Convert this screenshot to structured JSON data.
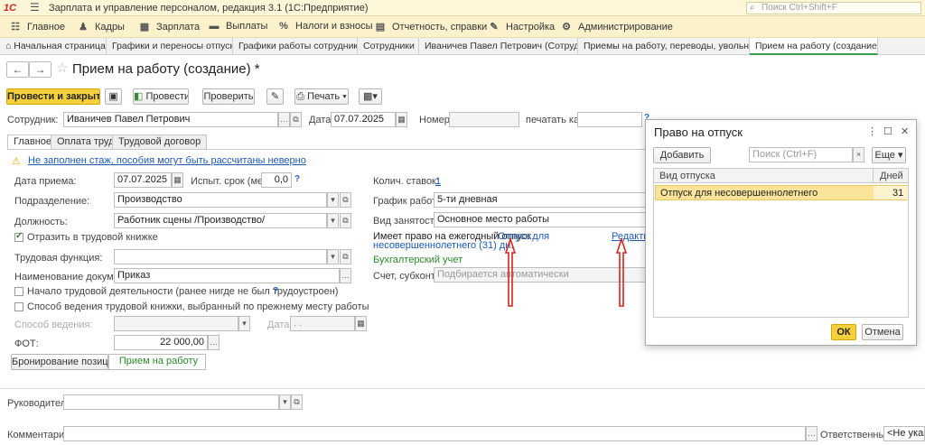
{
  "titlebar": {
    "logo": "1С",
    "app_title": "Зарплата и управление персоналом, редакция 3.1  (1С:Предприятие)",
    "search_placeholder": "Поиск Ctrl+Shift+F"
  },
  "menu": [
    {
      "label": "Главное",
      "icon": "grid-icon"
    },
    {
      "label": "Кадры",
      "icon": "people-icon"
    },
    {
      "label": "Зарплата",
      "icon": "calculator-icon"
    },
    {
      "label": "Выплаты",
      "icon": "wallet-icon"
    },
    {
      "label": "Налоги и взносы",
      "icon": "percent-icon"
    },
    {
      "label": "Отчетность, справки",
      "icon": "report-icon"
    },
    {
      "label": "Настройка",
      "icon": "wrench-icon"
    },
    {
      "label": "Администрирование",
      "icon": "gear-icon"
    }
  ],
  "tabs": [
    {
      "label": "Начальная страница"
    },
    {
      "label": "Графики и переносы отпусков"
    },
    {
      "label": "Графики работы сотрудников"
    },
    {
      "label": "Сотрудники"
    },
    {
      "label": "Иваничев Павел Петрович (Сотрудник)"
    },
    {
      "label": "Приемы на работу, переводы, увольнения"
    },
    {
      "label": "Прием на работу (создание) *"
    }
  ],
  "document": {
    "title": "Прием на работу (создание) *"
  },
  "toolbar": {
    "post_close": "Провести и закрыть",
    "post": "Провести",
    "check": "Проверить",
    "print": "Печать"
  },
  "header": {
    "employee_label": "Сотрудник:",
    "employee_value": "Иваничев Павел Петрович",
    "date_label": "Дата:",
    "date_value": "07.07.2025",
    "number_label": "Номер:",
    "print_as_label": "печатать как:"
  },
  "form_tabs": [
    "Главное",
    "Оплата труда",
    "Трудовой договор"
  ],
  "main": {
    "warning": "Не заполнен стаж, пособия могут быть рассчитаны неверно",
    "hire_date_label": "Дата приема:",
    "hire_date_value": "07.07.2025",
    "probation_label": "Испыт. срок (мес):",
    "probation_value": "0,0",
    "department_label": "Подразделение:",
    "department_value": "Производство",
    "position_label": "Должность:",
    "position_value": "Работник сцены /Производство/",
    "reflect_book_label": "Отразить в трудовой книжке",
    "labor_function_label": "Трудовая функция:",
    "doc_name_label": "Наименование документа:",
    "doc_name_value": "Приказ",
    "start_activity_label": "Начало трудовой деятельности (ранее нигде не был трудоустроен)",
    "book_method_label": "Способ ведения трудовой книжки, выбранный по прежнему месту работы",
    "method_label": "Способ ведения:",
    "date2_label": "Дата:",
    "date2_value": ". .",
    "fot_label": "ФОТ:",
    "fot_value": "22 000,00",
    "reserve_button": "Бронирование позиции",
    "hire_status": "Прием на работу",
    "rates_label": "Колич. ставок:",
    "rates_value": "1",
    "schedule_label": "График работы:",
    "schedule_value": "5-ти дневная",
    "employment_label": "Вид занятости:",
    "employment_value": "Основное место работы",
    "vacation_label": "Имеет право на ежегодный отпуск",
    "vacation_link": "Отпуск для",
    "vacation_link2": "несовершеннолетнего (31) дн.",
    "edit_link": "Редактир",
    "accounting_title": "Бухгалтерский учет",
    "account_label": "Счет, субконто:",
    "account_placeholder": "Подбирается автоматически"
  },
  "footer": {
    "manager_label": "Руководитель:",
    "comment_label": "Комментарий:",
    "responsible_label": "Ответственный:",
    "responsible_value": "<Не указан"
  },
  "popup": {
    "title": "Право на отпуск",
    "add_button": "Добавить",
    "search_placeholder": "Поиск (Ctrl+F)",
    "more_button": "Еще",
    "col_type": "Вид отпуска",
    "col_days": "Дней",
    "rows": [
      {
        "type": "Отпуск для несовершеннолетнего",
        "days": "31"
      }
    ],
    "ok": "ОК",
    "cancel": "Отмена"
  },
  "colors": {
    "accent_yellow": "#f6d03c",
    "arrow_red": "#d9231e",
    "link_blue": "#1d5ab5",
    "active_green": "#3aa04a"
  }
}
